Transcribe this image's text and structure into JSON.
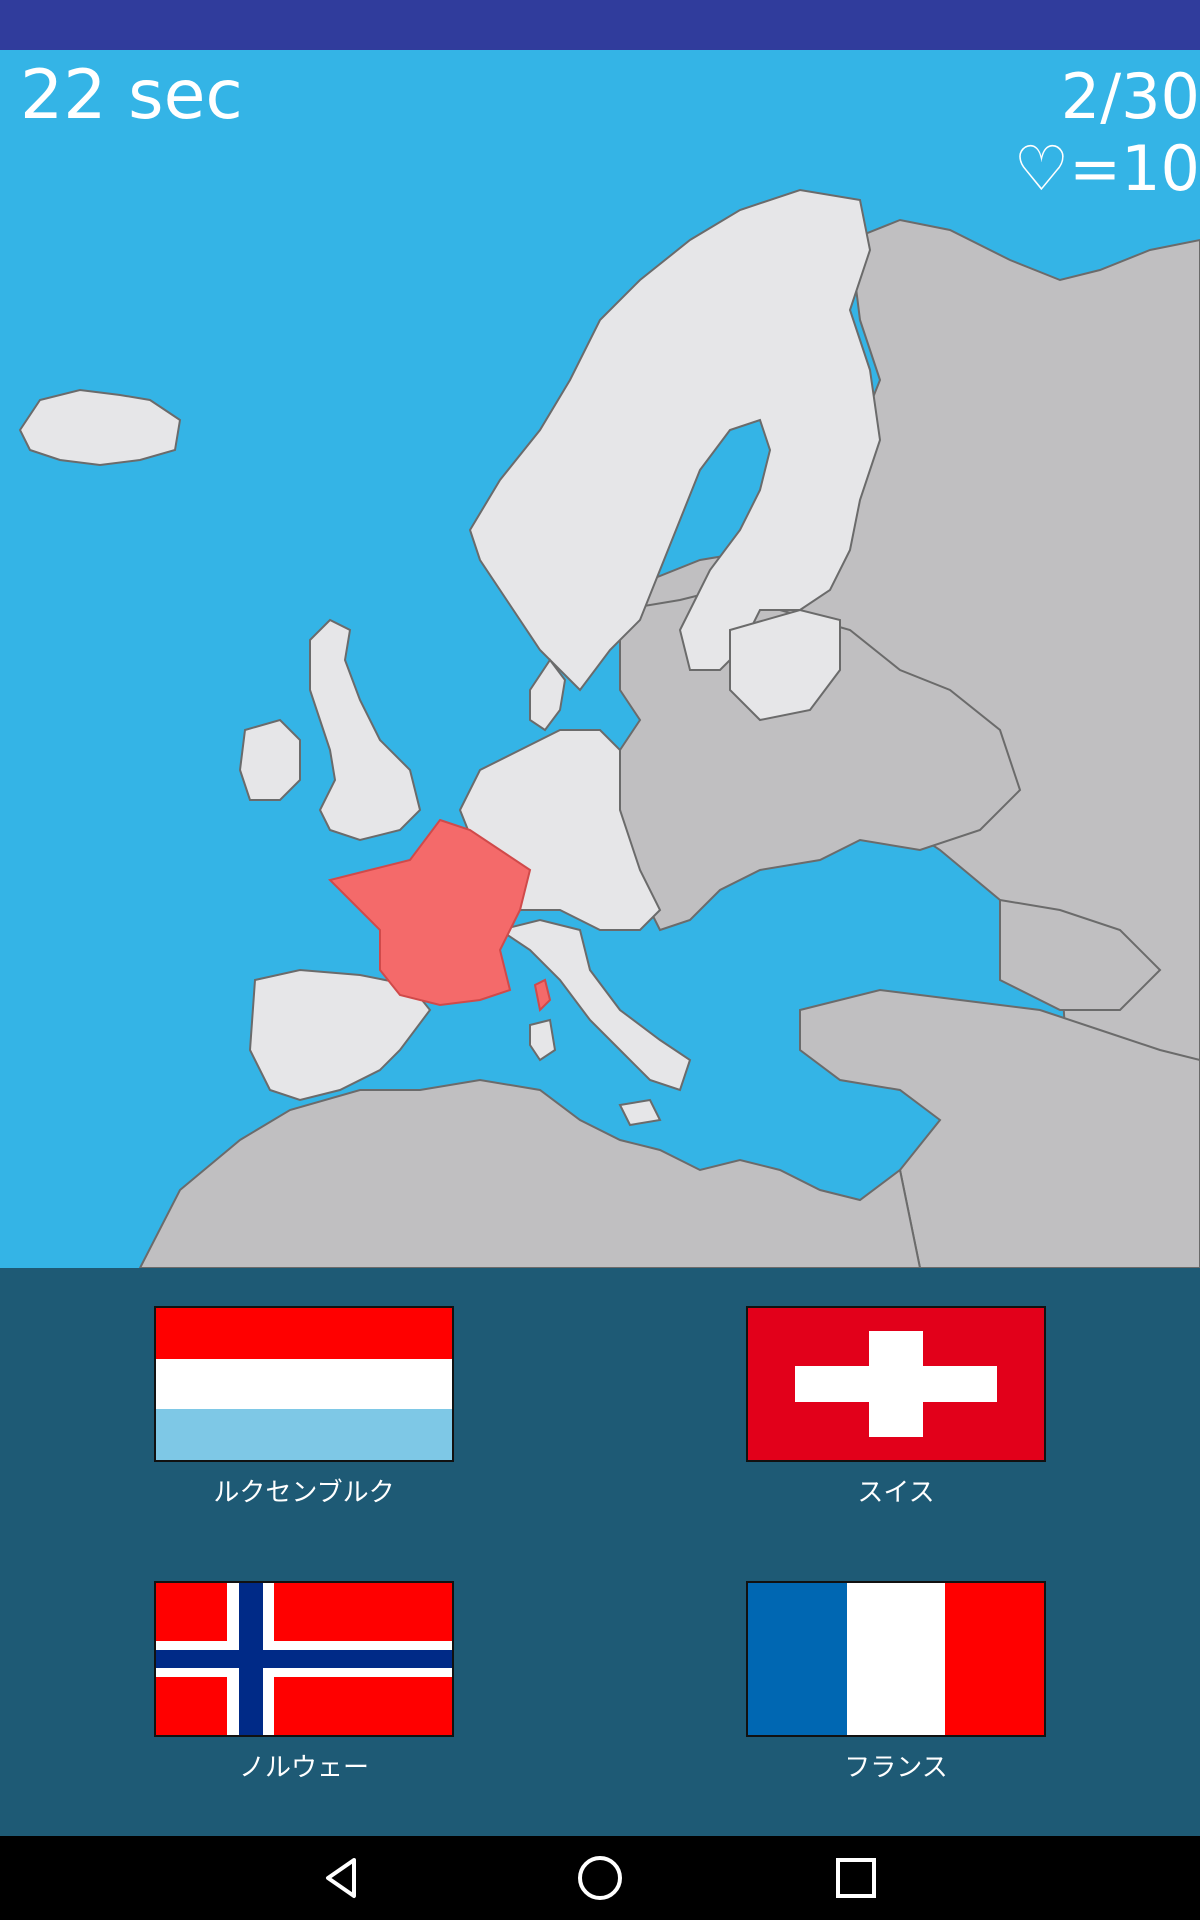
{
  "hud": {
    "timer": "22 sec",
    "progress": "2/30",
    "lives_symbol": "♡",
    "lives_text": "=10"
  },
  "map": {
    "highlighted_country": "France",
    "colors": {
      "sea": "#34b4e6",
      "europe_land": "#e6e6e8",
      "other_land": "#c0bfc1",
      "highlight": "#f46a6a",
      "border": "#6b6b6b"
    }
  },
  "answers": {
    "options": [
      {
        "label": "ルクセンブルク",
        "flag": "luxembourg-flag"
      },
      {
        "label": "スイス",
        "flag": "switzerland-flag"
      },
      {
        "label": "ノルウェー",
        "flag": "norway-flag"
      },
      {
        "label": "フランス",
        "flag": "france-flag"
      }
    ]
  },
  "nav": {
    "back": "back-icon",
    "home": "home-icon",
    "recents": "recents-icon"
  },
  "colors": {
    "status_bar": "#303c9c",
    "answer_panel": "#1e5a75"
  }
}
